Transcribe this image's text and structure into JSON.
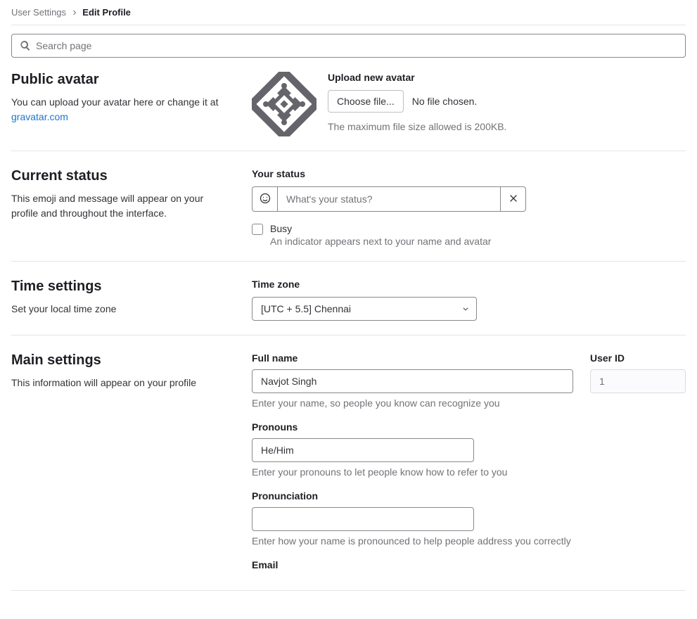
{
  "breadcrumb": {
    "parent": "User Settings",
    "current": "Edit Profile"
  },
  "search": {
    "placeholder": "Search page"
  },
  "avatar": {
    "title": "Public avatar",
    "desc_prefix": "You can upload your avatar here or change it at ",
    "gravatar_link": "gravatar.com",
    "upload_label": "Upload new avatar",
    "choose_btn": "Choose file...",
    "no_file": "No file chosen.",
    "max_size": "The maximum file size allowed is 200KB."
  },
  "status": {
    "title": "Current status",
    "desc": "This emoji and message will appear on your profile and throughout the interface.",
    "label": "Your status",
    "placeholder": "What's your status?",
    "busy_label": "Busy",
    "busy_help": "An indicator appears next to your name and avatar"
  },
  "time": {
    "title": "Time settings",
    "desc": "Set your local time zone",
    "label": "Time zone",
    "selected": "[UTC + 5.5] Chennai"
  },
  "main": {
    "title": "Main settings",
    "desc": "This information will appear on your profile",
    "fullname_label": "Full name",
    "fullname_value": "Navjot Singh",
    "fullname_help": "Enter your name, so people you know can recognize you",
    "userid_label": "User ID",
    "userid_value": "1",
    "pronouns_label": "Pronouns",
    "pronouns_value": "He/Him",
    "pronouns_help": "Enter your pronouns to let people know how to refer to you",
    "pronunciation_label": "Pronunciation",
    "pronunciation_value": "",
    "pronunciation_help": "Enter how your name is pronounced to help people address you correctly",
    "email_label": "Email"
  }
}
